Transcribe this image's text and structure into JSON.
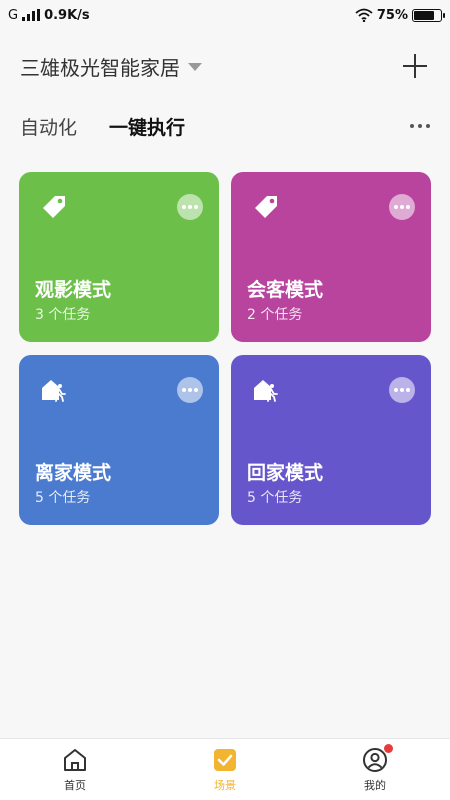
{
  "status_bar": {
    "network": "G",
    "speed": "0.9K/s",
    "battery_percent": "75%",
    "battery_level": 0.75,
    "icons": [
      "signal-icon",
      "wifi-icon",
      "battery-icon"
    ]
  },
  "header": {
    "home_name": "三雄极光智能家居",
    "dropdown_icon": "caret-down-icon",
    "add_icon": "plus-icon"
  },
  "tabs": [
    {
      "label": "自动化",
      "active": false
    },
    {
      "label": "一键执行",
      "active": true
    }
  ],
  "more_icon": "more-dots-icon",
  "scenes": [
    {
      "title": "观影模式",
      "subtitle": "3 个任务",
      "color": "#6cc04a",
      "icon": "tag-icon"
    },
    {
      "title": "会客模式",
      "subtitle": "2 个任务",
      "color": "#b8449e",
      "icon": "tag-icon"
    },
    {
      "title": "离家模式",
      "subtitle": "5 个任务",
      "color": "#4a7bcf",
      "icon": "leave-home-icon"
    },
    {
      "title": "回家模式",
      "subtitle": "5 个任务",
      "color": "#6656cc",
      "icon": "arrive-home-icon"
    }
  ],
  "bottom_nav": [
    {
      "label": "首页",
      "icon": "home-icon",
      "active": false
    },
    {
      "label": "场景",
      "icon": "scene-check-icon",
      "active": true
    },
    {
      "label": "我的",
      "icon": "profile-icon",
      "active": false,
      "badge": true
    }
  ],
  "colors": {
    "accent": "#f2b531",
    "badge": "#e73b3b"
  }
}
